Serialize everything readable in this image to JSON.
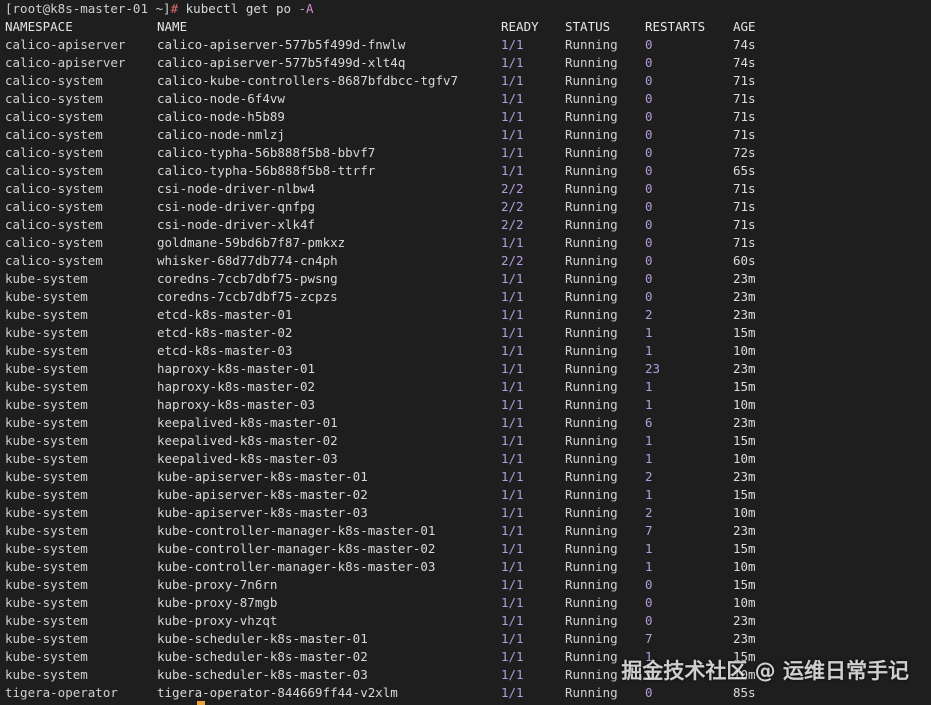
{
  "prompt": {
    "prefix": "[root@k8s-master-01 ~]",
    "hash": "#",
    "command": "kubectl get po",
    "flag": "-A"
  },
  "columns": {
    "namespace": "NAMESPACE",
    "name": "NAME",
    "ready": "READY",
    "status": "STATUS",
    "restarts": "RESTARTS",
    "age": "AGE"
  },
  "rows": [
    [
      "calico-apiserver",
      "calico-apiserver-577b5f499d-fnwlw",
      "1/1",
      "Running",
      "0",
      "74s"
    ],
    [
      "calico-apiserver",
      "calico-apiserver-577b5f499d-xlt4q",
      "1/1",
      "Running",
      "0",
      "74s"
    ],
    [
      "calico-system",
      "calico-kube-controllers-8687bfdbcc-tgfv7",
      "1/1",
      "Running",
      "0",
      "71s"
    ],
    [
      "calico-system",
      "calico-node-6f4vw",
      "1/1",
      "Running",
      "0",
      "71s"
    ],
    [
      "calico-system",
      "calico-node-h5b89",
      "1/1",
      "Running",
      "0",
      "71s"
    ],
    [
      "calico-system",
      "calico-node-nmlzj",
      "1/1",
      "Running",
      "0",
      "71s"
    ],
    [
      "calico-system",
      "calico-typha-56b888f5b8-bbvf7",
      "1/1",
      "Running",
      "0",
      "72s"
    ],
    [
      "calico-system",
      "calico-typha-56b888f5b8-ttrfr",
      "1/1",
      "Running",
      "0",
      "65s"
    ],
    [
      "calico-system",
      "csi-node-driver-nlbw4",
      "2/2",
      "Running",
      "0",
      "71s"
    ],
    [
      "calico-system",
      "csi-node-driver-qnfpg",
      "2/2",
      "Running",
      "0",
      "71s"
    ],
    [
      "calico-system",
      "csi-node-driver-xlk4f",
      "2/2",
      "Running",
      "0",
      "71s"
    ],
    [
      "calico-system",
      "goldmane-59bd6b7f87-pmkxz",
      "1/1",
      "Running",
      "0",
      "71s"
    ],
    [
      "calico-system",
      "whisker-68d77db774-cn4ph",
      "2/2",
      "Running",
      "0",
      "60s"
    ],
    [
      "kube-system",
      "coredns-7ccb7dbf75-pwsng",
      "1/1",
      "Running",
      "0",
      "23m"
    ],
    [
      "kube-system",
      "coredns-7ccb7dbf75-zcpzs",
      "1/1",
      "Running",
      "0",
      "23m"
    ],
    [
      "kube-system",
      "etcd-k8s-master-01",
      "1/1",
      "Running",
      "2",
      "23m"
    ],
    [
      "kube-system",
      "etcd-k8s-master-02",
      "1/1",
      "Running",
      "1",
      "15m"
    ],
    [
      "kube-system",
      "etcd-k8s-master-03",
      "1/1",
      "Running",
      "1",
      "10m"
    ],
    [
      "kube-system",
      "haproxy-k8s-master-01",
      "1/1",
      "Running",
      "23",
      "23m"
    ],
    [
      "kube-system",
      "haproxy-k8s-master-02",
      "1/1",
      "Running",
      "1",
      "15m"
    ],
    [
      "kube-system",
      "haproxy-k8s-master-03",
      "1/1",
      "Running",
      "1",
      "10m"
    ],
    [
      "kube-system",
      "keepalived-k8s-master-01",
      "1/1",
      "Running",
      "6",
      "23m"
    ],
    [
      "kube-system",
      "keepalived-k8s-master-02",
      "1/1",
      "Running",
      "1",
      "15m"
    ],
    [
      "kube-system",
      "keepalived-k8s-master-03",
      "1/1",
      "Running",
      "1",
      "10m"
    ],
    [
      "kube-system",
      "kube-apiserver-k8s-master-01",
      "1/1",
      "Running",
      "2",
      "23m"
    ],
    [
      "kube-system",
      "kube-apiserver-k8s-master-02",
      "1/1",
      "Running",
      "1",
      "15m"
    ],
    [
      "kube-system",
      "kube-apiserver-k8s-master-03",
      "1/1",
      "Running",
      "2",
      "10m"
    ],
    [
      "kube-system",
      "kube-controller-manager-k8s-master-01",
      "1/1",
      "Running",
      "7",
      "23m"
    ],
    [
      "kube-system",
      "kube-controller-manager-k8s-master-02",
      "1/1",
      "Running",
      "1",
      "15m"
    ],
    [
      "kube-system",
      "kube-controller-manager-k8s-master-03",
      "1/1",
      "Running",
      "1",
      "10m"
    ],
    [
      "kube-system",
      "kube-proxy-7n6rn",
      "1/1",
      "Running",
      "0",
      "15m"
    ],
    [
      "kube-system",
      "kube-proxy-87mgb",
      "1/1",
      "Running",
      "0",
      "10m"
    ],
    [
      "kube-system",
      "kube-proxy-vhzqt",
      "1/1",
      "Running",
      "0",
      "23m"
    ],
    [
      "kube-system",
      "kube-scheduler-k8s-master-01",
      "1/1",
      "Running",
      "7",
      "23m"
    ],
    [
      "kube-system",
      "kube-scheduler-k8s-master-02",
      "1/1",
      "Running",
      "1",
      "15m"
    ],
    [
      "kube-system",
      "kube-scheduler-k8s-master-03",
      "1/1",
      "Running",
      "1",
      "10m"
    ],
    [
      "tigera-operator",
      "tigera-operator-844669ff44-v2xlm",
      "1/1",
      "Running",
      "0",
      "85s"
    ]
  ],
  "watermark": "掘金技术社区 @ 运维日常手记",
  "colors": {
    "background": "#1e1e1e",
    "prompt_hash": "#e46b6b",
    "flag": "#d08ed0",
    "ready_restarts": "#b39ddb",
    "cursor": "#e8a33d"
  }
}
